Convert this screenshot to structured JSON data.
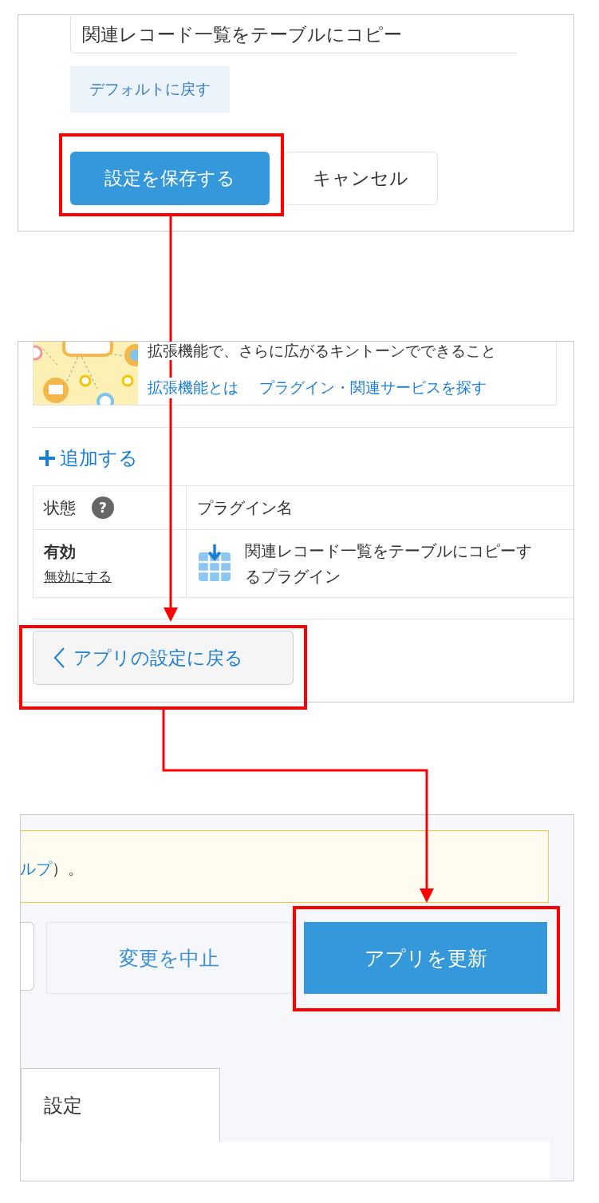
{
  "plugin_settings_panel": {
    "field": {
      "value": "関連レコード一覧をテーブルにコピー"
    },
    "reset_button": "デフォルトに戻す",
    "save_button": "設定を保存する",
    "cancel_button": "キャンセル"
  },
  "plugin_list_panel": {
    "promo": {
      "heading": "拡張機能で、さらに広がるキントーンでできること",
      "links": [
        "拡張機能とは",
        "プラグイン・関連サービスを探す"
      ]
    },
    "add_link": "追加する",
    "table": {
      "columns": [
        "状態",
        "プラグイン名"
      ],
      "help_glyph": "?",
      "rows": [
        {
          "status": "有効",
          "toggle_link": "無効にする",
          "name": "関連レコード一覧をテーブルにコピーするプラグイン"
        }
      ]
    },
    "back_button": "アプリの設定に戻る"
  },
  "app_settings_panel": {
    "notice": {
      "link": "ルプ",
      "text": "）。"
    },
    "discard_button": "変更を中止",
    "update_button": "アプリを更新",
    "tabs": [
      {
        "label": "設定",
        "selected": true
      }
    ]
  }
}
